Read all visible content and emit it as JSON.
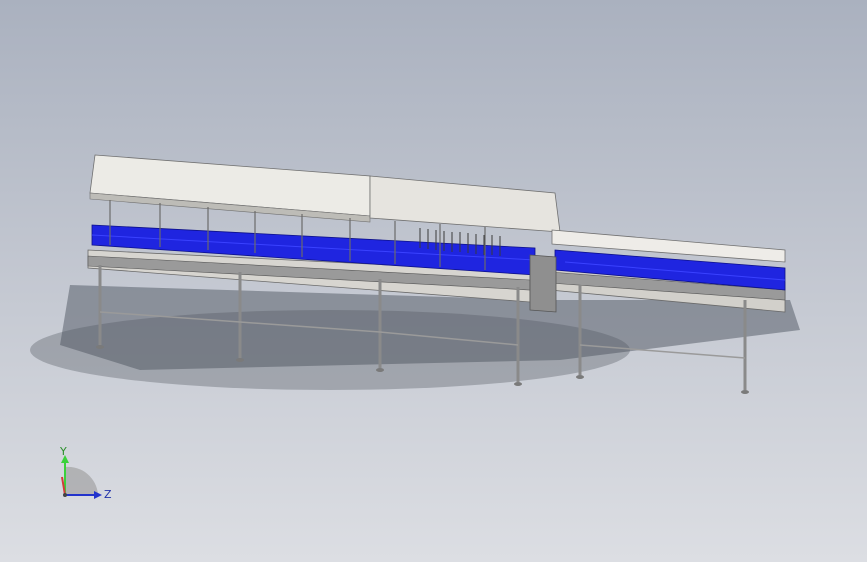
{
  "viewport": {
    "background_top": "#aab1bf",
    "background_bottom": "#dcdee3"
  },
  "model": {
    "description_icon": "conveyor-machine-3d-model",
    "colors": {
      "belt": "#1f25e0",
      "hood": "#e9e7e2",
      "frame": "#9a9a9a",
      "legs": "#8e8e8e",
      "shadow": "#5d636d"
    }
  },
  "triad": {
    "y_label": "Y",
    "z_label": "Z",
    "y_color": "#3bd13b",
    "z_color": "#2233cc",
    "x_color": "#d13b3b"
  }
}
